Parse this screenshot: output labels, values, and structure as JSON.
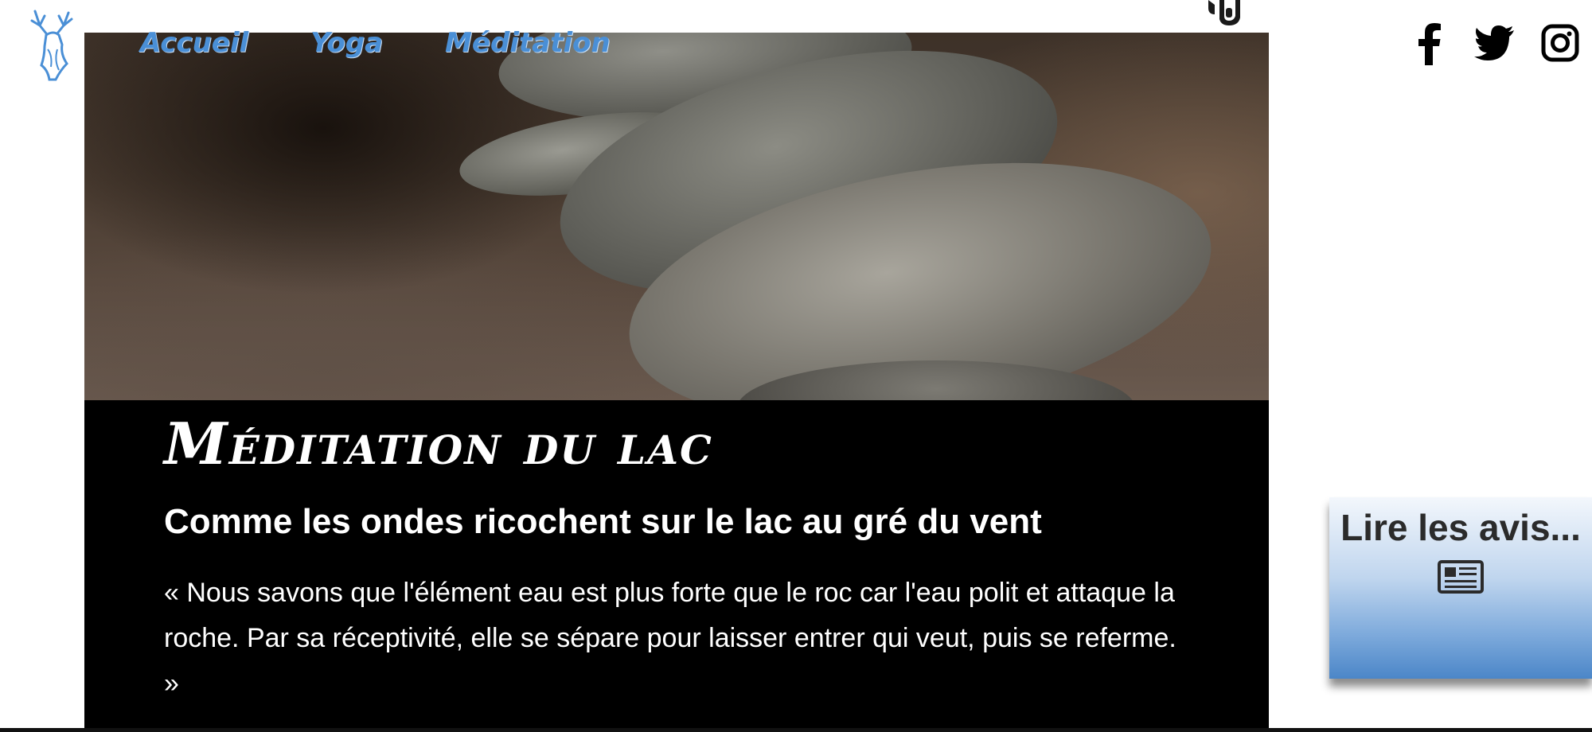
{
  "nav": {
    "items": [
      {
        "label": "Accueil"
      },
      {
        "label": "Yoga"
      },
      {
        "label": "Méditation"
      }
    ]
  },
  "icons": {
    "logo": "deer-logo-icon",
    "top": "headset-icon",
    "facebook": "facebook-icon",
    "twitter": "twitter-icon",
    "instagram": "instagram-icon",
    "reviews": "newspaper-icon"
  },
  "hero": {
    "title": "Méditation du lac",
    "subtitle": "Comme les ondes ricochent sur le lac au gré du vent",
    "quote": "« Nous savons que l'élément eau est plus forte que le roc car l'eau polit et attaque la roche. Par sa réceptivité, elle se sépare pour laisser entrer qui veut, puis se referme. »"
  },
  "reviews": {
    "label": "Lire les avis..."
  },
  "colors": {
    "nav": "#4a8fd6",
    "panel": "#000000",
    "review_gradient_top": "#f3f7fc",
    "review_gradient_bottom": "#4b86c8"
  }
}
